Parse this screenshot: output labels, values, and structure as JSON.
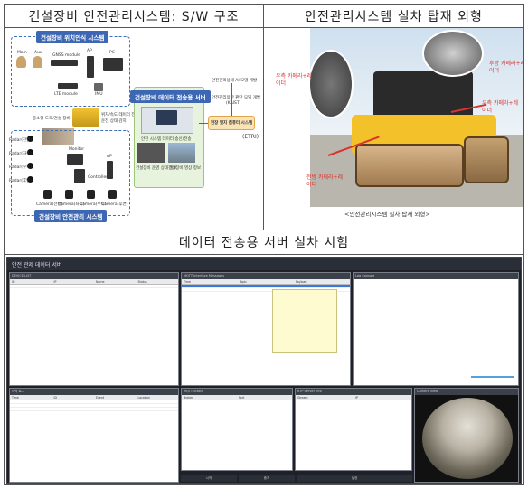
{
  "cells": {
    "top_left_title": "건설장비 안전관리시스템: S/W 구조",
    "top_right_title": "안전관리시스템 실차 탑재 외형",
    "bottom_title": "데이터 전송용 서버 실차 시험"
  },
  "diagram": {
    "pos_box_tag": "건설장비 위치인식 시스템",
    "main_label": "Main",
    "aux_label": "Aux",
    "gnss_label": "GNSS module",
    "ap_label": "AP",
    "pc_label": "PC",
    "lte_label": "LTE module",
    "imu_label": "IMU",
    "server_tag": "건설장비 데이터 전송용 서버",
    "monitor_label": "Monitor",
    "controller_label": "Controller",
    "ap2_label": "AP",
    "safety_box_tag": "건설장비 안전관리 시스템",
    "field_label": "현장 맺지 컴퓨터 시스템",
    "etri_label": "(ETRI)",
    "kaist_label": "(KAIST)",
    "ai_label": "안전관리상태 AI 모델 개발",
    "kaist_sub": "안전관리의한 판단 모델 개발",
    "equip_label": "중소형 도로/건설 장비",
    "send_label": "위치/속도 데이터 전송",
    "cond_label": "운전 상태 감지",
    "radars": [
      "Radar(전면)",
      "Radar(좌측)",
      "Radar(우측)",
      "Radar(후면)"
    ],
    "cameras": [
      "Camera(전면)",
      "Camera(좌측)",
      "Camera(우측)",
      "Camera(후면)"
    ],
    "server_caption1": "안전 시스템 데이터 송신/전송",
    "server_caption2": "건설장비 운영 상태 정보",
    "server_caption3": "건설장비 영상 정보"
  },
  "photo": {
    "right_cam": "우측 카메라+레\n이더",
    "rear_cam": "후방 카메라+레\n이더",
    "left_cam": "우측 카메라+레\n이더",
    "front_cam": "전방 카메라+레\n이더",
    "caption": "<안전관리시스템 실차 탑재 외형>"
  },
  "server_ui": {
    "window_title": "안전 관제 데이터 서버",
    "pane1_title": "DEVICE LIST",
    "pane1_cols": [
      "ID",
      "IP",
      "Name",
      "Status"
    ],
    "pane2_title": "MQTT Interface Messages",
    "pane2_cols": [
      "Time",
      "Topic",
      "Payload"
    ],
    "pane3_title": "Log Console",
    "pane4_title": "이력 로그",
    "pane4_cols": [
      "Time",
      "ID",
      "Event",
      "Location"
    ],
    "pane5_title": "MQTT Status",
    "pane5_cols": [
      "Broker",
      "Port"
    ],
    "pane6_title": "RTP Server Info",
    "pane6_cols": [
      "Stream",
      "IP"
    ],
    "pane7_title": "Camera View",
    "buttons": [
      "시작",
      "중지",
      "설정"
    ]
  },
  "colors": {
    "accent_blue": "#3d67b3",
    "callout_red": "#d8332e",
    "app_dark": "#1e2127",
    "selection": "#3b78d8"
  }
}
